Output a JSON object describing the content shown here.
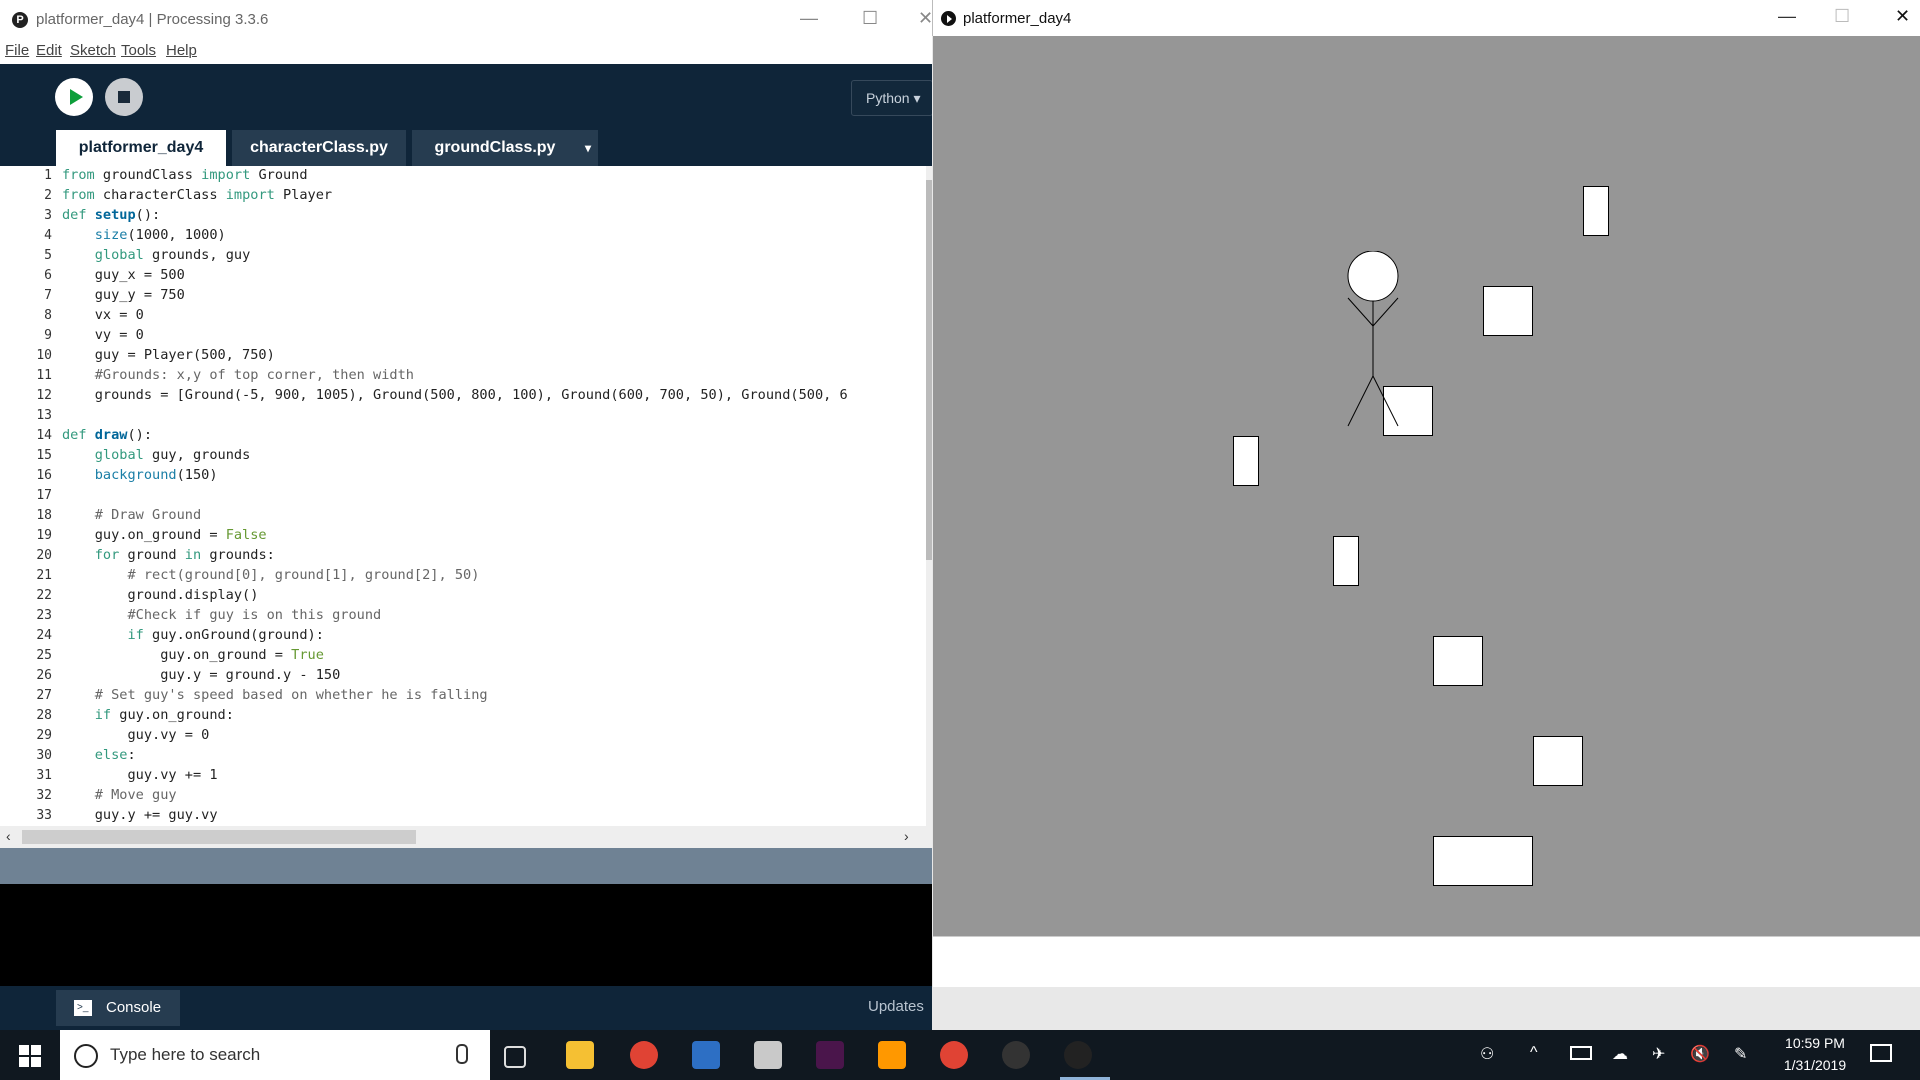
{
  "ide": {
    "title": "platformer_day4 | Processing 3.3.6",
    "menu": [
      "File",
      "Edit",
      "Sketch",
      "Tools",
      "Help"
    ],
    "mode": "Python ▾",
    "tabs": [
      "platformer_day4",
      "characterClass.py",
      "groundClass.py"
    ],
    "tab_menu": "▾",
    "console_label": "Console",
    "updates_label": "Updates"
  },
  "code": {
    "line_numbers": [
      "1",
      "2",
      "3",
      "4",
      "5",
      "6",
      "7",
      "8",
      "9",
      "10",
      "11",
      "12",
      "13",
      "14",
      "15",
      "16",
      "17",
      "18",
      "19",
      "20",
      "21",
      "22",
      "23",
      "24",
      "25",
      "26",
      "27",
      "28",
      "29",
      "30",
      "31",
      "32",
      "33"
    ],
    "lines": [
      "from groundClass import Ground",
      "from characterClass import Player",
      "def setup():",
      "    size(1000, 1000)",
      "    global grounds, guy",
      "    guy_x = 500",
      "    guy_y = 750",
      "    vx = 0",
      "    vy = 0",
      "    guy = Player(500, 750)",
      "    #Grounds: x,y of top corner, then width",
      "    grounds = [Ground(-5, 900, 1005), Ground(500, 800, 100), Ground(600, 700, 50), Ground(500, 6",
      "",
      "def draw():",
      "    global guy, grounds",
      "    background(150)",
      "",
      "    # Draw Ground",
      "    guy.on_ground = False",
      "    for ground in grounds:",
      "        # rect(ground[0], ground[1], ground[2], 50)",
      "        ground.display()",
      "        #Check if guy is on this ground",
      "        if guy.onGround(ground):",
      "            guy.on_ground = True",
      "            guy.y = ground.y - 150",
      "    # Set guy's speed based on whether he is falling",
      "    if guy.on_ground:",
      "        guy.vy = 0",
      "    else:",
      "        guy.vy += 1",
      "    # Move guy",
      "    guy.y += guy.vy"
    ]
  },
  "sketch": {
    "title": "platformer_day4"
  },
  "taskbar": {
    "search_placeholder": "Type here to search",
    "time": "10:59 PM",
    "date": "1/31/2019"
  },
  "colors": {
    "toolbar_bg": "#0f2539",
    "run_green": "#0d9e3a",
    "canvas_bg": "#969696"
  },
  "icons": [
    "processing-icon",
    "run-icon",
    "stop-icon",
    "console-icon",
    "windows-start-icon",
    "search-icon",
    "mic-icon",
    "task-view-icon",
    "file-explorer-icon",
    "chrome-icon",
    "powershell-icon",
    "slack-icon",
    "sublime-icon",
    "action-center-icon"
  ]
}
